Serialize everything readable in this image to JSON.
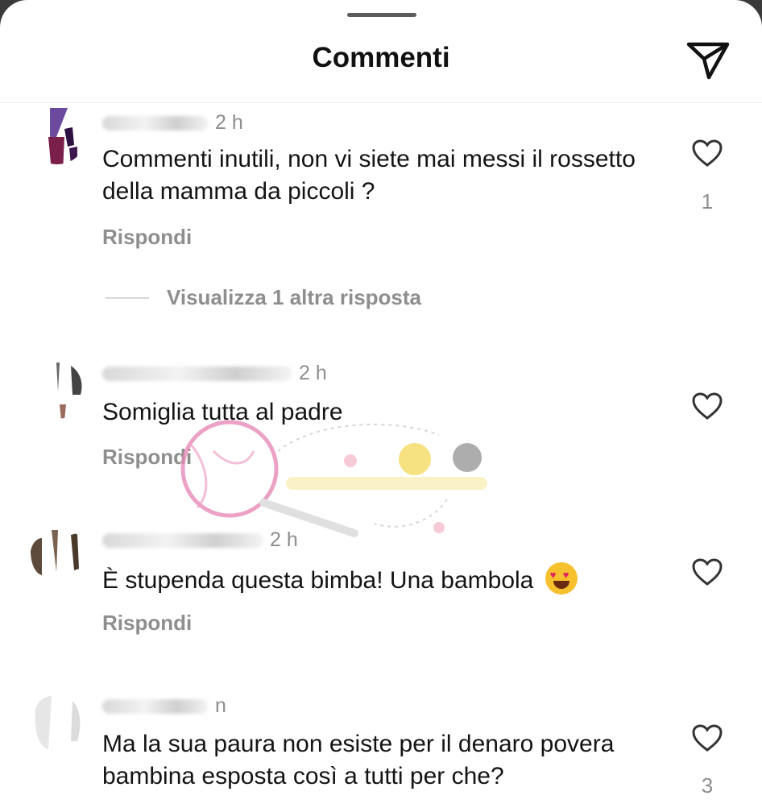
{
  "header": {
    "title": "Commenti",
    "share_icon": "paper-plane-icon"
  },
  "comments": [
    {
      "username": "",
      "time": "2 h",
      "text": "Commenti inutili, non vi siete mai  messi il rossetto della mamma da piccoli ?",
      "reply_label": "Rispondi",
      "likes": "1",
      "more_replies": "Visualizza 1 altra risposta"
    },
    {
      "username": "",
      "time": "2 h",
      "text": "Somiglia tutta al padre",
      "reply_label": "Rispondi"
    },
    {
      "username": "",
      "time": "2 h",
      "text": "È stupenda questa bimba! Una bambola",
      "reply_label": "Rispondi",
      "emoji": "heart-eyes-emoji"
    },
    {
      "username": "",
      "time": "n",
      "text": "Ma la sua paura non esiste per il denaro povera bambina esposta così a tutti  per che?",
      "likes": "3"
    }
  ],
  "colors": {
    "background": "#ffffff",
    "text": "#141414",
    "secondary": "#8e8e8e",
    "watermark_pink": "#e88ab8"
  }
}
